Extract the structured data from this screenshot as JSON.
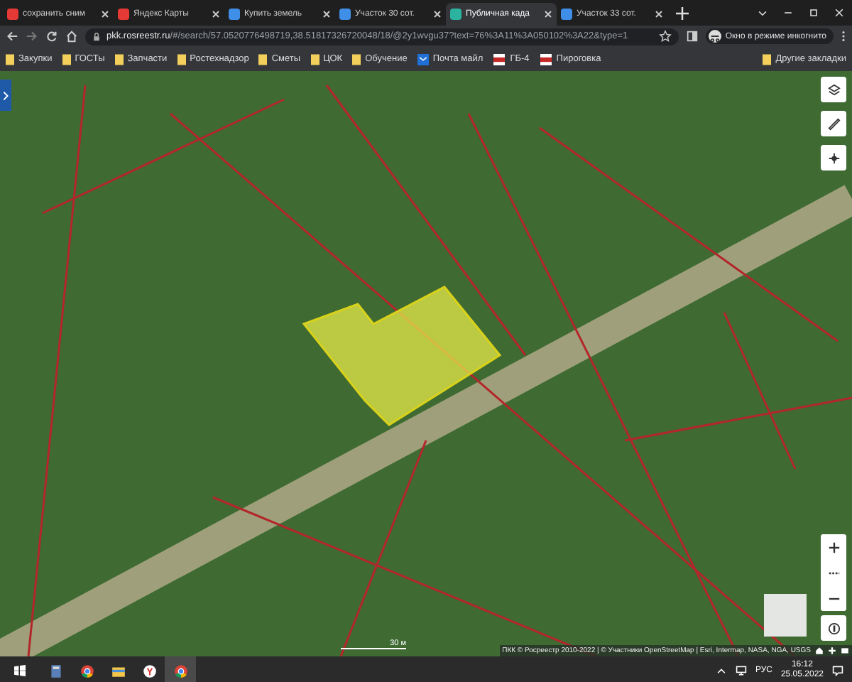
{
  "tabs": [
    {
      "label": "сохранить сним",
      "selected": false,
      "color": "#e53935"
    },
    {
      "label": "Яндекс Карты",
      "selected": false,
      "color": "#e53935"
    },
    {
      "label": "Купить земель",
      "selected": false,
      "color": "#3f8ee8"
    },
    {
      "label": "Участок 30 сот.",
      "selected": false,
      "color": "#3f8ee8"
    },
    {
      "label": "Публичная када",
      "selected": true,
      "color": "#2bb3a0"
    },
    {
      "label": "Участок 33 сот.",
      "selected": false,
      "color": "#3f8ee8"
    }
  ],
  "address_bar": {
    "host": "pkk.rosreestr.ru",
    "path": "/#/search/57.0520776498719,38.51817326720048/18/@2y1wvgu37?text=76%3A11%3A050102%3A22&type=1"
  },
  "profile": {
    "label": "Окно в режиме инкогнито"
  },
  "bookmarks": [
    {
      "label": "Закупки",
      "kind": "folder"
    },
    {
      "label": "ГОСТы",
      "kind": "folder"
    },
    {
      "label": "Запчасти",
      "kind": "folder"
    },
    {
      "label": "Ростехнадзор",
      "kind": "folder"
    },
    {
      "label": "Сметы",
      "kind": "folder"
    },
    {
      "label": "ЦОК",
      "kind": "folder"
    },
    {
      "label": "Обучение",
      "kind": "folder"
    },
    {
      "label": "Почта майл",
      "kind": "mail"
    },
    {
      "label": "ГБ-4",
      "kind": "site"
    },
    {
      "label": "Пироговка",
      "kind": "site"
    }
  ],
  "other_bookmarks": {
    "label": "Другие закладки"
  },
  "map": {
    "scale": "30 м",
    "attribution": "ПКК © Росреестр 2010-2022 | © Участники OpenStreetMap | Esri, Intermap, NASA, NGA, USGS"
  },
  "taskbar": {
    "apps": [
      {
        "kind": "calculator",
        "selected": false
      },
      {
        "kind": "chrome",
        "selected": false
      },
      {
        "kind": "explorer",
        "selected": false
      },
      {
        "kind": "yandex",
        "selected": false
      },
      {
        "kind": "chrome",
        "selected": true
      }
    ],
    "language": "РУС",
    "time": "16:12",
    "date": "25.05.2022"
  }
}
